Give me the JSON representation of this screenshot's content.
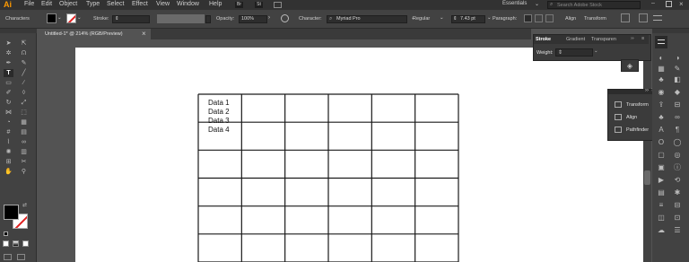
{
  "app": {
    "logo": "Ai"
  },
  "menu": [
    "File",
    "Edit",
    "Object",
    "Type",
    "Select",
    "Effect",
    "View",
    "Window",
    "Help"
  ],
  "header_right": {
    "workspace": "Essentials",
    "search_placeholder": "Search Adobe Stock",
    "br": "Br",
    "st": "St"
  },
  "control": {
    "left_label": "Characters",
    "stroke_label": "Stroke:",
    "opacity_label": "Opacity:",
    "opacity_value": "100%",
    "character_label": "Character:",
    "font_name": "Myriad Pro",
    "font_style": "Regular",
    "font_size": "7.43 pt",
    "paragraph_label": "Paragraph:",
    "align_label": "Align",
    "transform_label": "Transform"
  },
  "document_tab": {
    "title": "Untitled-1* @ 214% (RGB/Preview)",
    "close": "×"
  },
  "stroke_panel": {
    "tabs": [
      "Stroke",
      "Gradient",
      "Transparen"
    ],
    "weight_label": "Weight:"
  },
  "floating_panel": {
    "items": [
      {
        "icon": "transform-icon",
        "label": "Transform"
      },
      {
        "icon": "align-icon",
        "label": "Align"
      },
      {
        "icon": "pathfinder-icon",
        "label": "Pathfinder"
      }
    ]
  },
  "table": {
    "rows": 6,
    "cols": 6,
    "first_cell_lines": [
      "Data 1",
      "Data 2",
      "Data 3",
      "Data 4"
    ]
  },
  "colors": {
    "accent": "#ff9a00",
    "fill_swatch": "#000000",
    "stroke_swatch": "#ffffff",
    "artboard": "#ffffff",
    "grid_line": "#1a1a1a"
  }
}
